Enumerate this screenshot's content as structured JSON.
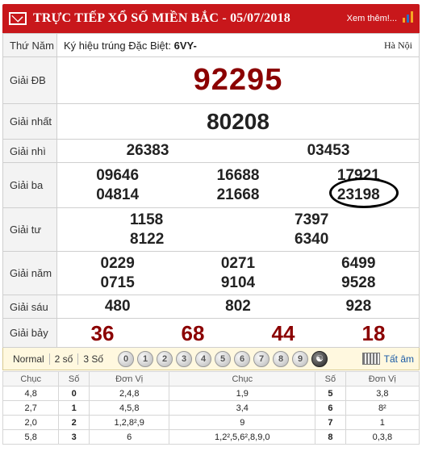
{
  "header": {
    "title": "TRỰC TIẾP XỔ SỐ MIỀN BẮC - 05/07/2018",
    "more": "Xem thêm!..."
  },
  "info": {
    "day": "Thứ Năm",
    "code_label": "Ký hiệu trúng Đặc Biệt:",
    "code": "6VY-",
    "region": "Hà Nội"
  },
  "prizes": {
    "db": {
      "label": "Giải ĐB",
      "values": [
        "92295"
      ]
    },
    "nhat": {
      "label": "Giải nhất",
      "values": [
        "80208"
      ]
    },
    "nhi": {
      "label": "Giải nhì",
      "values": [
        "26383",
        "03453"
      ]
    },
    "ba": {
      "label": "Giải ba",
      "values": [
        "09646",
        "16688",
        "17921",
        "04814",
        "21668",
        "23198"
      ]
    },
    "tu": {
      "label": "Giải tư",
      "values": [
        "1158",
        "7397",
        "8122",
        "6340"
      ]
    },
    "nam": {
      "label": "Giải năm",
      "values": [
        "0229",
        "0271",
        "6499",
        "0715",
        "9104",
        "9528"
      ]
    },
    "sau": {
      "label": "Giải sáu",
      "values": [
        "480",
        "802",
        "928"
      ]
    },
    "bay": {
      "label": "Giải bảy",
      "values": [
        "36",
        "68",
        "44",
        "18"
      ]
    }
  },
  "toolbar": {
    "modes": [
      "Normal",
      "2 số",
      "3 Số"
    ],
    "digits": [
      "0",
      "1",
      "2",
      "3",
      "4",
      "5",
      "6",
      "7",
      "8",
      "9"
    ],
    "all": "Tất âm"
  },
  "loto": {
    "headers": [
      "Chục",
      "Số",
      "Đơn Vị",
      "Chục",
      "Số",
      "Đơn Vị"
    ],
    "rows": [
      [
        "4,8",
        "0",
        "2,4,8",
        "1,9",
        "5",
        "3,8"
      ],
      [
        "2,7",
        "1",
        "4,5,8",
        "3,4",
        "6",
        "8²"
      ],
      [
        "2,0",
        "2",
        "1,2,8²,9",
        "9",
        "7",
        "1"
      ],
      [
        "5,8",
        "3",
        "6",
        "1,2²,5,6²,8,9,0",
        "8",
        "0,3,8"
      ]
    ]
  },
  "colors": {
    "header_bg": "#c8171b",
    "special": "#8b0000"
  }
}
